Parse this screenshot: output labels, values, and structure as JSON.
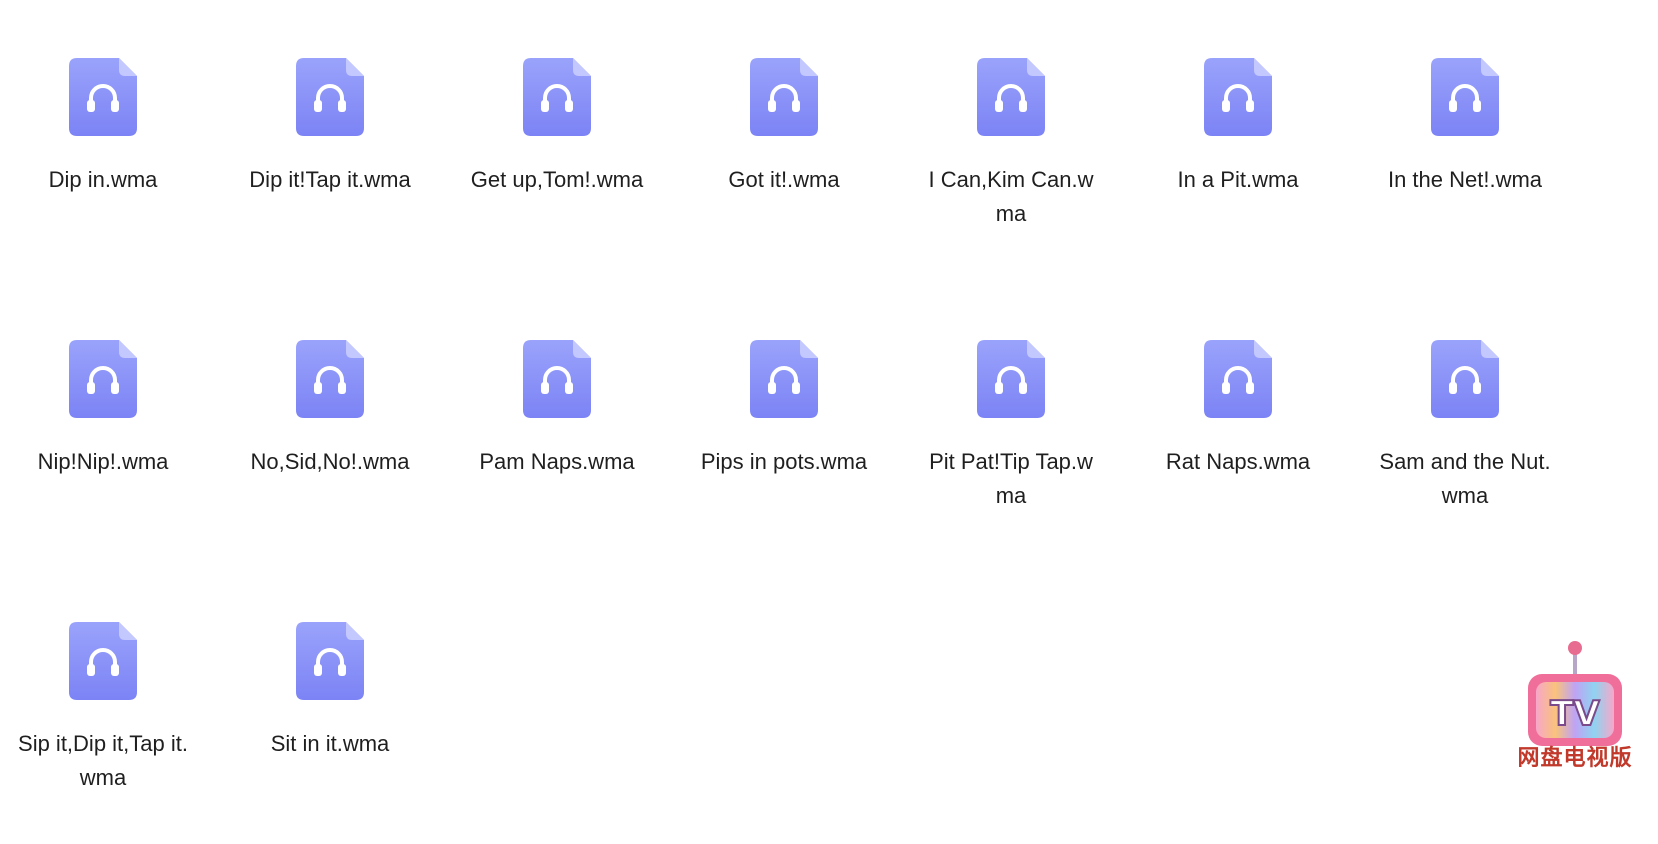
{
  "files": [
    {
      "name": "Dip in.wma",
      "icon": "audio-file-icon"
    },
    {
      "name": "Dip it!Tap it.wma",
      "icon": "audio-file-icon"
    },
    {
      "name": "Get up,Tom!.wma",
      "icon": "audio-file-icon"
    },
    {
      "name": "Got it!.wma",
      "icon": "audio-file-icon"
    },
    {
      "name": "I Can,Kim Can.wma",
      "icon": "audio-file-icon"
    },
    {
      "name": "In a Pit.wma",
      "icon": "audio-file-icon"
    },
    {
      "name": "In the Net!.wma",
      "icon": "audio-file-icon"
    },
    {
      "name": "Nip!Nip!.wma",
      "icon": "audio-file-icon"
    },
    {
      "name": "No,Sid,No!.wma",
      "icon": "audio-file-icon"
    },
    {
      "name": "Pam Naps.wma",
      "icon": "audio-file-icon"
    },
    {
      "name": "Pips in pots.wma",
      "icon": "audio-file-icon"
    },
    {
      "name": "Pit Pat!Tip Tap.wma",
      "icon": "audio-file-icon"
    },
    {
      "name": "Rat Naps.wma",
      "icon": "audio-file-icon"
    },
    {
      "name": "Sam and the Nut.wma",
      "icon": "audio-file-icon"
    },
    {
      "name": "Sip it,Dip it,Tap it.wma",
      "icon": "audio-file-icon"
    },
    {
      "name": "Sit in it.wma",
      "icon": "audio-file-icon"
    }
  ],
  "watermark": {
    "logo_text": "TV",
    "caption": "网盘电视版",
    "icon": "tv-logo-icon"
  },
  "colors": {
    "icon_fill_top": "#9aa3fb",
    "icon_fill_bottom": "#7c83f5",
    "icon_fold": "#c3c8ff",
    "headphone": "#ffffff",
    "text": "#1f1f1f",
    "watermark_text": "#c0392b"
  }
}
